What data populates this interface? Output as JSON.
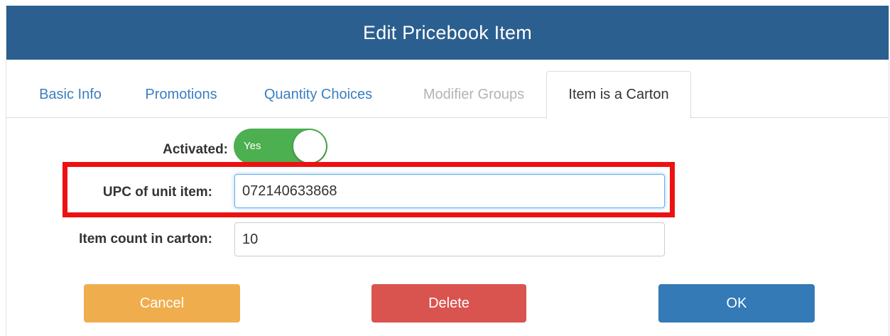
{
  "dialog": {
    "title": "Edit Pricebook Item"
  },
  "tabs": [
    {
      "label": "Basic Info",
      "state": "normal"
    },
    {
      "label": "Promotions",
      "state": "normal"
    },
    {
      "label": "Quantity Choices",
      "state": "normal"
    },
    {
      "label": "Modifier Groups",
      "state": "disabled"
    },
    {
      "label": "Item is a Carton",
      "state": "active"
    }
  ],
  "form": {
    "activated_label": "Activated:",
    "activated_toggle_text": "Yes",
    "upc_label": "UPC of unit item:",
    "upc_value": "072140633868",
    "count_label": "Item count in carton:",
    "count_value": "10"
  },
  "buttons": {
    "cancel": "Cancel",
    "delete": "Delete",
    "ok": "OK"
  },
  "colors": {
    "header": "#2b5f8f",
    "tab_link": "#3b7ec0",
    "toggle_on": "#4caf50",
    "highlight": "#ee1111",
    "cancel": "#f0ad4e",
    "delete": "#d9534f",
    "ok": "#337ab7"
  }
}
